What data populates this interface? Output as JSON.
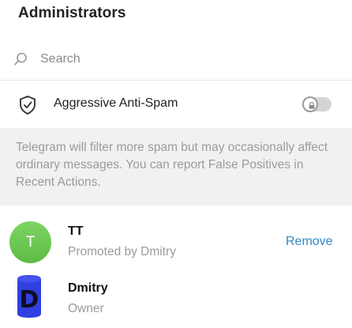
{
  "header": {
    "title": "Administrators"
  },
  "search": {
    "placeholder": "Search",
    "icon": "search-icon"
  },
  "antispam": {
    "label": "Aggressive Anti-Spam",
    "icon": "shield-check-icon",
    "toggle_on": false,
    "toggle_locked": true,
    "description": "Telegram will filter more spam but may occasionally affect ordinary messages. You can report False Positives in Recent Actions."
  },
  "admins": [
    {
      "initial": "T",
      "name": "TT",
      "subtitle": "Promoted by Dmitry",
      "action_label": "Remove",
      "avatar_color": "#6cc653"
    },
    {
      "avatar_letter": "D",
      "name": "Dmitry",
      "subtitle": "Owner"
    }
  ],
  "colors": {
    "accent": "#2b8ac4",
    "muted_text": "#9b9b9b",
    "info_bg": "#f1f1f1"
  }
}
